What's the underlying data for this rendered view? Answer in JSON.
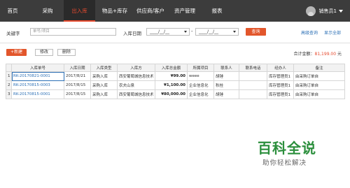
{
  "nav": {
    "items": [
      {
        "label": "首页"
      },
      {
        "label": "采购"
      },
      {
        "label": "出入库"
      },
      {
        "label": "物品+库存"
      },
      {
        "label": "供应商/客户"
      },
      {
        "label": "资产管理"
      },
      {
        "label": "报表"
      }
    ],
    "active_index": 2,
    "user_name": "销售员1"
  },
  "filter": {
    "keyword_label": "关键字",
    "keyword_placeholder": "单号/项目",
    "date_label": "入库日期",
    "date_from": "____/__/__",
    "date_to": "____/__/__",
    "date_separator": "-",
    "query_button": "查询",
    "advanced_link": "高级查询",
    "all_link": "显示全部"
  },
  "toolbar": {
    "new_button": "+新建",
    "edit_button": "修改",
    "delete_button": "删除",
    "total_label": "合计金额：",
    "total_amount": "81,199.00",
    "total_unit": "元"
  },
  "table": {
    "headers": [
      "入库单号",
      "入库日期",
      "入库类型",
      "入库方",
      "入库总金额",
      "所属项目",
      "联系人",
      "联系电话",
      "经办人",
      "备注"
    ],
    "rows": [
      [
        "1",
        "RK-20170821-0001",
        "2017/8/21",
        "采购入库",
        "西安葡萄城信息技术",
        "¥99.00",
        "weee",
        "胡锤",
        "",
        "库存管理员1",
        "由采购订单自"
      ],
      [
        "2",
        "RK-20170815-0003",
        "2017/8/15",
        "采购入库",
        "农夫山泉",
        "¥1,100.00",
        "企业信息化",
        "秋桂",
        "",
        "库存管理员1",
        "由采购订单自"
      ],
      [
        "3",
        "RK-20170815-0001",
        "2017/8/15",
        "采购入库",
        "西安葡萄城信息技术",
        "¥80,000.00",
        "企业信息化",
        "胡锤",
        "",
        "库存管理员1",
        "由采购订单自"
      ]
    ]
  },
  "watermark": {
    "title": "百科全说",
    "subtitle": "助你轻松解决"
  },
  "colors": {
    "nav_bg": "#3c3c3c",
    "accent": "#e64a2e",
    "link": "#2b6fb5",
    "watermark": "#2c8f3d"
  }
}
